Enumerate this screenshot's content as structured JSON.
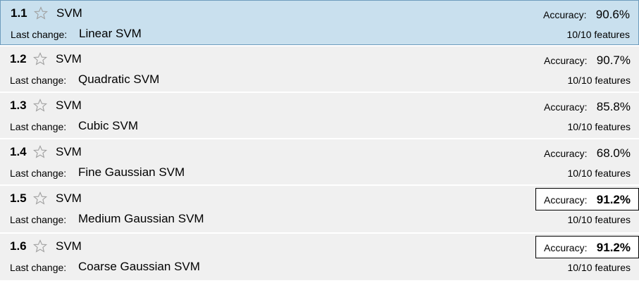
{
  "labels": {
    "last_change": "Last change:",
    "accuracy": "Accuracy:"
  },
  "colors": {
    "row_background": "#f0f0f0",
    "selected_background": "#c9e0ee",
    "selected_border": "#6e9cbd",
    "star_outline": "#a0a0a0",
    "best_accuracy_border": "#000000"
  },
  "models": [
    {
      "id": "1.1",
      "type": "SVM",
      "last_change": "Linear SVM",
      "accuracy": "90.6%",
      "features": "10/10 features",
      "selected": true,
      "best": false
    },
    {
      "id": "1.2",
      "type": "SVM",
      "last_change": "Quadratic SVM",
      "accuracy": "90.7%",
      "features": "10/10 features",
      "selected": false,
      "best": false
    },
    {
      "id": "1.3",
      "type": "SVM",
      "last_change": "Cubic SVM",
      "accuracy": "85.8%",
      "features": "10/10 features",
      "selected": false,
      "best": false
    },
    {
      "id": "1.4",
      "type": "SVM",
      "last_change": "Fine Gaussian SVM",
      "accuracy": "68.0%",
      "features": "10/10 features",
      "selected": false,
      "best": false
    },
    {
      "id": "1.5",
      "type": "SVM",
      "last_change": "Medium Gaussian SVM",
      "accuracy": "91.2%",
      "features": "10/10 features",
      "selected": false,
      "best": true
    },
    {
      "id": "1.6",
      "type": "SVM",
      "last_change": "Coarse Gaussian SVM",
      "accuracy": "91.2%",
      "features": "10/10 features",
      "selected": false,
      "best": true
    }
  ]
}
